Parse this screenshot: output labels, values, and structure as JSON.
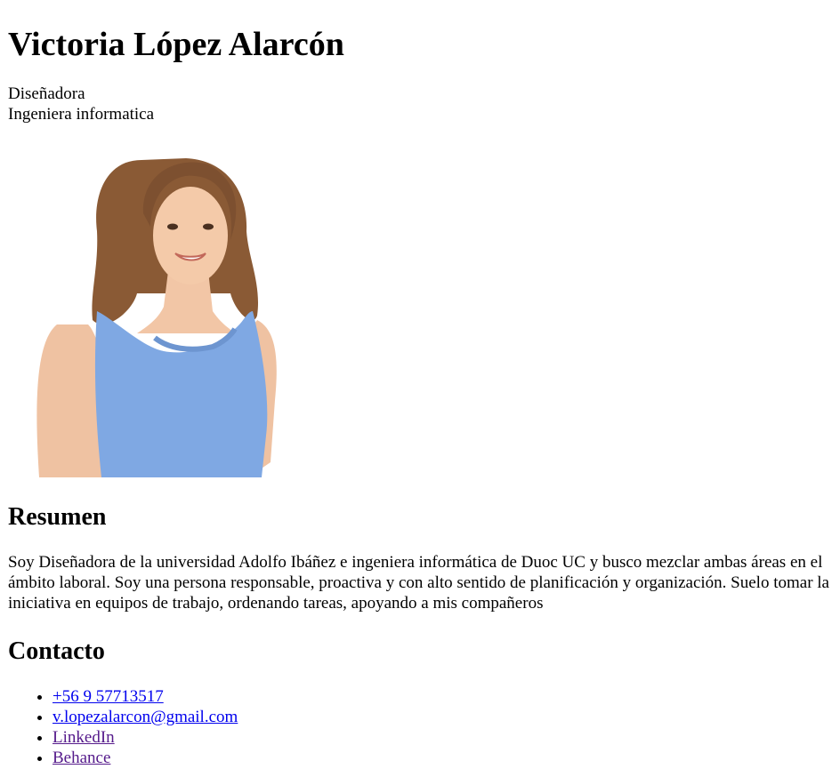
{
  "header": {
    "name": "Victoria López Alarcón",
    "role_1": "Diseñadora",
    "role_2": "Ingeniera informatica"
  },
  "photo": {
    "alt": "Victoria López Alarcón",
    "shirt_color": "#7fa8e3",
    "hair_color": "#8a5a35",
    "skin_color": "#f0c4a4"
  },
  "resumen": {
    "title": "Resumen",
    "text": "Soy Diseñadora de la universidad Adolfo Ibáñez e ingeniera informática de Duoc UC y busco mezclar ambas áreas en el ámbito laboral. Soy una persona responsable, proactiva y con alto sentido de planificación y organización. Suelo tomar la iniciativa en equipos de trabajo, ordenando tareas, apoyando a mis compañeros"
  },
  "contacto": {
    "title": "Contacto",
    "items": [
      {
        "label": "+56 9 57713517"
      },
      {
        "label": "v.lopezalarcon@gmail.com"
      },
      {
        "label": "LinkedIn"
      },
      {
        "label": "Behance"
      }
    ]
  },
  "colors": {
    "link": "#0000ee",
    "visited_link": "#551a8b",
    "text": "#000000",
    "background": "#ffffff"
  }
}
